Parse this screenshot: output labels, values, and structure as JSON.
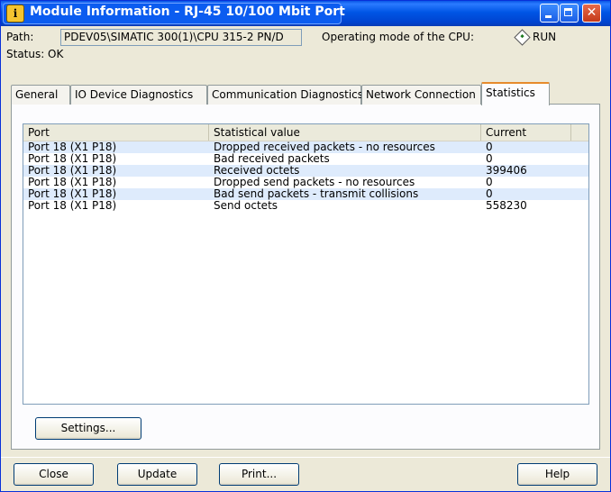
{
  "window": {
    "title": "Module Information - RJ-45 10/100 Mbit Port",
    "icon": "info-module-icon",
    "controls": [
      "minimize-icon",
      "maximize-icon",
      "close-icon"
    ]
  },
  "header": {
    "path_label": "Path:",
    "path_value": "PDEV05\\SIMATIC 300(1)\\CPU 315-2 PN/D",
    "mode_label": "Operating mode of the  CPU:",
    "mode_value": "RUN",
    "status_label": "Status:",
    "status_value": "OK"
  },
  "tabs": [
    {
      "label": "General"
    },
    {
      "label": "IO Device Diagnostics"
    },
    {
      "label": "Communication Diagnostics"
    },
    {
      "label": "Network Connection"
    },
    {
      "label": "Statistics",
      "active": true
    }
  ],
  "table": {
    "columns": [
      "Port",
      "Statistical value",
      "Current"
    ],
    "rows": [
      {
        "port": "Port 18 (X1 P18)",
        "stat": "Dropped received packets - no resources",
        "current": "0"
      },
      {
        "port": "Port 18 (X1 P18)",
        "stat": "Bad received packets",
        "current": "0"
      },
      {
        "port": "Port 18 (X1 P18)",
        "stat": "Received octets",
        "current": "399406"
      },
      {
        "port": "Port 18 (X1 P18)",
        "stat": "Dropped send packets - no resources",
        "current": "0"
      },
      {
        "port": "Port 18 (X1 P18)",
        "stat": "Bad send packets - transmit collisions",
        "current": "0"
      },
      {
        "port": "Port 18 (X1 P18)",
        "stat": "Send octets",
        "current": "558230"
      }
    ]
  },
  "buttons": {
    "settings": "Settings...",
    "close": "Close",
    "update": "Update",
    "print": "Print...",
    "help": "Help"
  },
  "colors": {
    "titlebar": "#0055e5",
    "alt_row": "#deebfc",
    "active_tab_accent": "#e68b2c"
  }
}
